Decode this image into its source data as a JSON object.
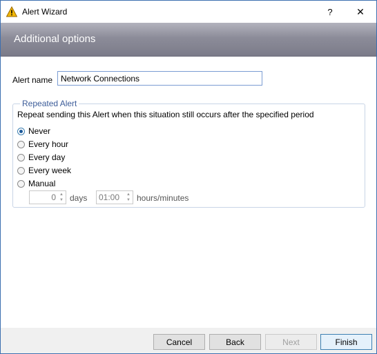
{
  "window": {
    "title": "Alert Wizard",
    "help_label": "?",
    "close_label": "✕",
    "icon": "warning-icon"
  },
  "header": {
    "title": "Additional options"
  },
  "alert_name": {
    "label": "Alert name",
    "value": "Network Connections"
  },
  "repeated_alert": {
    "legend": "Repeated Alert",
    "description": "Repeat sending this Alert when this situation still occurs after the specified period",
    "options": [
      {
        "label": "Never",
        "checked": true
      },
      {
        "label": "Every hour",
        "checked": false
      },
      {
        "label": "Every day",
        "checked": false
      },
      {
        "label": "Every week",
        "checked": false
      },
      {
        "label": "Manual",
        "checked": false
      }
    ],
    "days_value": "0",
    "days_unit": "days",
    "time_value": "01:00",
    "time_unit": "hours/minutes"
  },
  "buttons": {
    "cancel": "Cancel",
    "back": "Back",
    "next": "Next",
    "finish": "Finish"
  },
  "colors": {
    "accent": "#3c7fb1",
    "header_gradient_top": "#b3b3bd",
    "header_gradient_bottom": "#7b7b89",
    "legend_text": "#3c5c99"
  }
}
